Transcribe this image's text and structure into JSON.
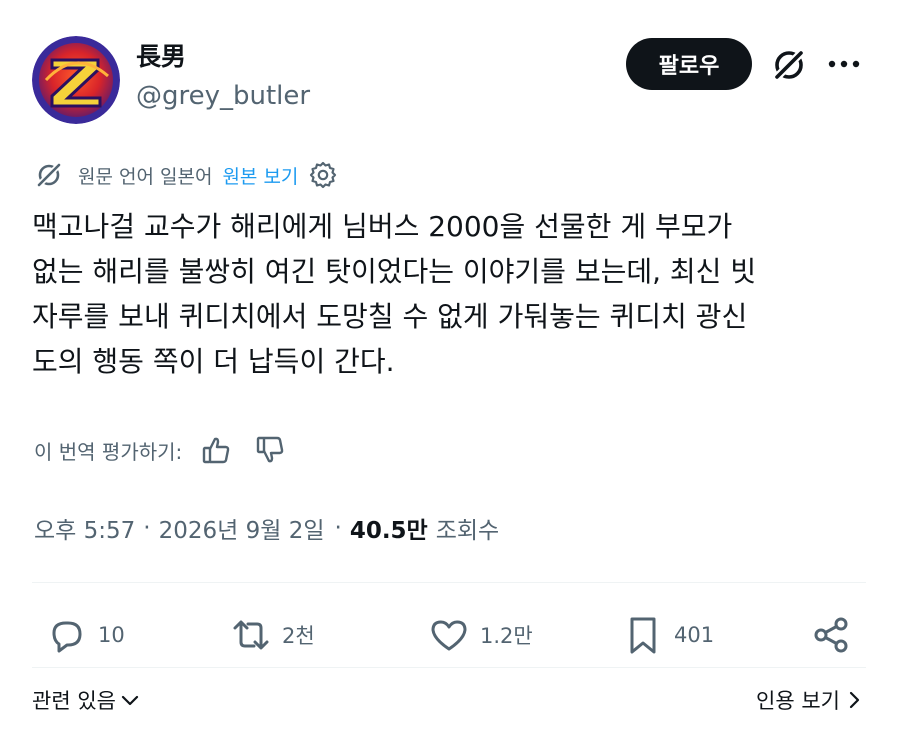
{
  "author": {
    "display_name": "長男",
    "handle": "@grey_butler"
  },
  "follow_label": "팔로우",
  "translation": {
    "original_language_text": "원문 언어 일본어",
    "view_original_label": "원본 보기"
  },
  "tweet": {
    "lines": [
      "맥고나걸 교수가 해리에게 님버스 2000을 선물한 게 부모가",
      "없는 해리를 불쌍히 여긴 탓이었다는 이야기를 보는데, 최신 빗",
      "자루를 보내 퀴디치에서 도망칠 수 없게 가둬놓는 퀴디치 광신",
      "도의 행동 쪽이 더 납득이 간다."
    ]
  },
  "rate_translation_label": "이 번역 평가하기:",
  "meta": {
    "time": "오후 5:57",
    "separator": "·",
    "date": "2026년 9월 2일",
    "views_count": "40.5만",
    "views_label": "조회수"
  },
  "actions": {
    "replies": "10",
    "reposts": "2천",
    "likes": "1.2만",
    "bookmarks": "401"
  },
  "footer": {
    "related_label": "관련 있음",
    "quotes_label": "인용 보기"
  },
  "colors": {
    "text_primary": "#0f1419",
    "text_secondary": "#536471",
    "link": "#1d9bf0",
    "divider": "#eff3f4"
  }
}
